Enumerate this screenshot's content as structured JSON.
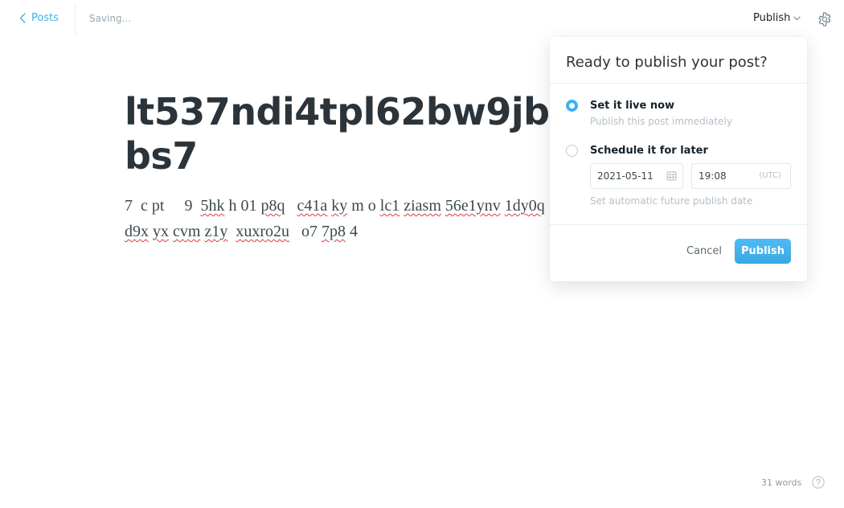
{
  "header": {
    "back_label": "Posts",
    "status": "Saving...",
    "publish_label": "Publish"
  },
  "post": {
    "title_lines": [
      "lt537ndi4tpl62bw9jbf1l",
      "bs7"
    ],
    "body_line_1": [
      {
        "t": "7",
        "u": false
      },
      {
        "t": "  ",
        "u": false
      },
      {
        "t": "c",
        "u": false
      },
      {
        "t": " ",
        "u": false
      },
      {
        "t": "pt",
        "u": false
      },
      {
        "t": "     ",
        "u": false
      },
      {
        "t": "9",
        "u": false
      },
      {
        "t": "  ",
        "u": false
      },
      {
        "t": "5hk",
        "u": true
      },
      {
        "t": " ",
        "u": false
      },
      {
        "t": "h",
        "u": false
      },
      {
        "t": " ",
        "u": false
      },
      {
        "t": "01",
        "u": false
      },
      {
        "t": " ",
        "u": false
      },
      {
        "t": "p8q",
        "u": true
      },
      {
        "t": "   ",
        "u": false
      },
      {
        "t": "c41a",
        "u": true
      },
      {
        "t": " ",
        "u": false
      },
      {
        "t": "ky",
        "u": true
      },
      {
        "t": " ",
        "u": false
      },
      {
        "t": "m",
        "u": false
      },
      {
        "t": " ",
        "u": false
      },
      {
        "t": "o",
        "u": false
      },
      {
        "t": " ",
        "u": false
      },
      {
        "t": "lc1",
        "u": true
      },
      {
        "t": " ",
        "u": false
      },
      {
        "t": "ziasm",
        "u": true
      },
      {
        "t": " ",
        "u": false
      },
      {
        "t": "56e1ynv",
        "u": true
      },
      {
        "t": " ",
        "u": false
      },
      {
        "t": "1dy0q",
        "u": true
      }
    ],
    "body_line_2": [
      {
        "t": "d9x",
        "u": true
      },
      {
        "t": " ",
        "u": false
      },
      {
        "t": "yx",
        "u": true
      },
      {
        "t": " ",
        "u": false
      },
      {
        "t": "cvm",
        "u": true
      },
      {
        "t": " ",
        "u": false
      },
      {
        "t": "z1y",
        "u": true
      },
      {
        "t": "  ",
        "u": false
      },
      {
        "t": "xuxro2u",
        "u": true
      },
      {
        "t": "   ",
        "u": false
      },
      {
        "t": "o7",
        "u": false
      },
      {
        "t": " ",
        "u": false
      },
      {
        "t": "7p8",
        "u": true
      },
      {
        "t": " ",
        "u": false
      },
      {
        "t": "4",
        "u": false
      }
    ]
  },
  "publish_popover": {
    "title": "Ready to publish your post?",
    "option_now": {
      "label": "Set it live now",
      "description": "Publish this post immediately",
      "selected": true
    },
    "option_schedule": {
      "label": "Schedule it for later",
      "date": "2021-05-11",
      "time": "19:08",
      "timezone": "(UTC)",
      "description": "Set automatic future publish date",
      "selected": false
    },
    "cancel_label": "Cancel",
    "publish_label": "Publish"
  },
  "footer": {
    "word_count": "31 words"
  },
  "colors": {
    "accent": "#3eb0ef",
    "spellcheck": "#e0363c",
    "muted_text": "#b5c0c8"
  },
  "icons": {
    "back": "chevron-left-icon",
    "publish_menu": "chevron-down-icon",
    "settings": "gear-icon",
    "date": "calendar-icon",
    "help": "question-circle-icon"
  }
}
